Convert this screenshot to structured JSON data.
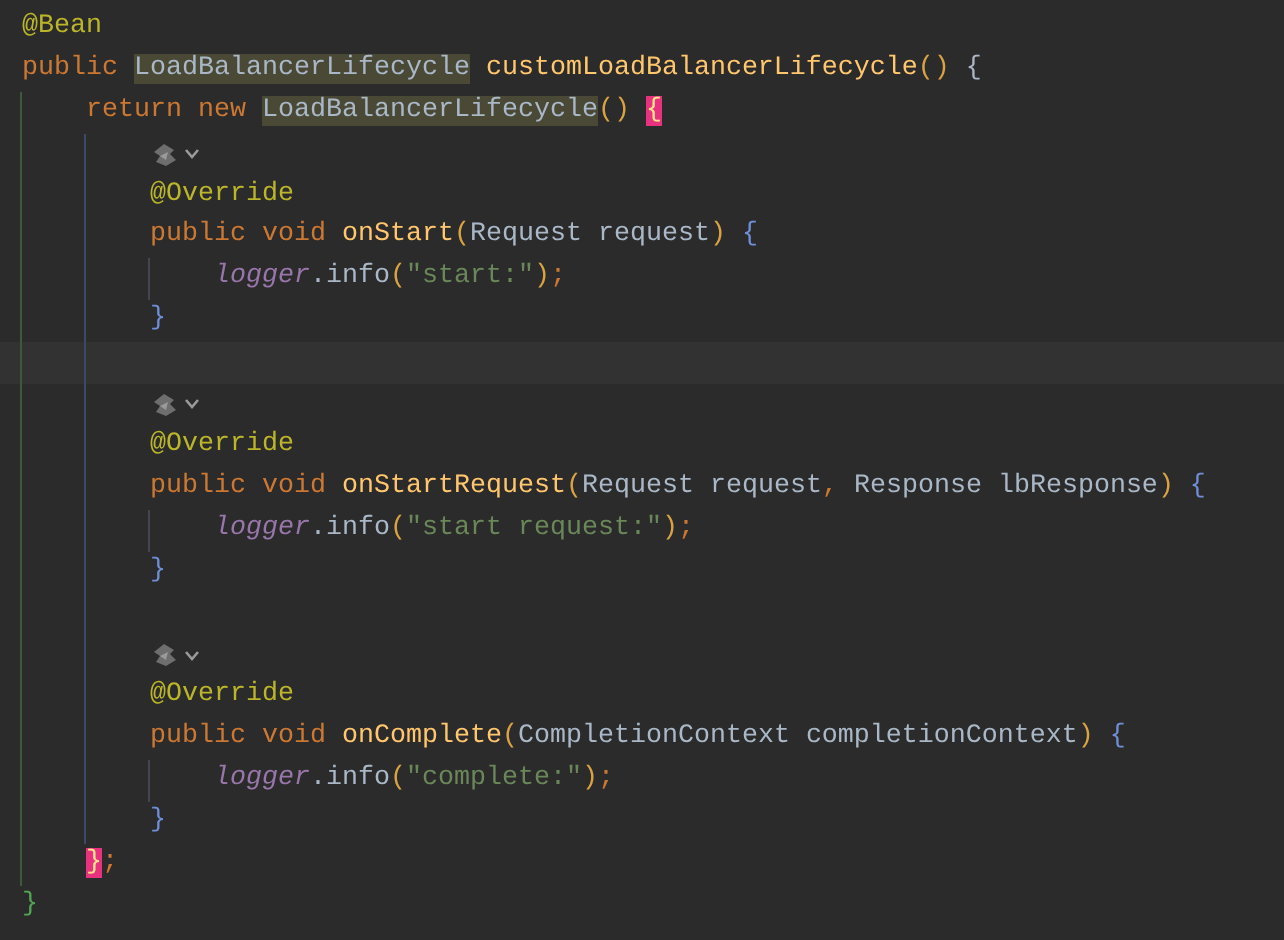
{
  "editor": {
    "lines": [
      {
        "kind": "code",
        "tokens": [
          {
            "kind": "annotation",
            "text": "@Bean"
          }
        ]
      },
      {
        "kind": "code",
        "tokens": [
          {
            "kind": "keyword",
            "text": "public "
          },
          {
            "kind": "type_usage",
            "text": "LoadBalancerLifecycle"
          },
          {
            "kind": "method",
            "text": " customLoadBalancerLifecycle"
          },
          {
            "kind": "bracket_1",
            "text": "()"
          },
          {
            "kind": "identifier",
            "text": " {"
          }
        ],
        "children": [
          {
            "kind": "code",
            "tokens": [
              {
                "kind": "keyword",
                "text": "return new "
              },
              {
                "kind": "type_usage",
                "text": "LoadBalancerLifecycle"
              },
              {
                "kind": "bracket_1",
                "text": "() "
              },
              {
                "kind": "bracket_match",
                "text": "{"
              }
            ],
            "children": [
              {
                "kind": "marker"
              },
              {
                "kind": "code",
                "tokens": [
                  {
                    "kind": "annotation",
                    "text": "@Override"
                  }
                ]
              },
              {
                "kind": "code",
                "tokens": [
                  {
                    "kind": "keyword",
                    "text": "public void "
                  },
                  {
                    "kind": "method",
                    "text": "onStart"
                  },
                  {
                    "kind": "bracket_1",
                    "text": "("
                  },
                  {
                    "kind": "type",
                    "text": "Request "
                  },
                  {
                    "kind": "identifier",
                    "text": "request"
                  },
                  {
                    "kind": "bracket_1",
                    "text": ")"
                  },
                  {
                    "kind": "bracket_2",
                    "text": " {"
                  }
                ],
                "children": [
                  {
                    "kind": "code",
                    "tokens": [
                      {
                        "kind": "field",
                        "text": "logger"
                      },
                      {
                        "kind": "identifier",
                        "text": ".info"
                      },
                      {
                        "kind": "bracket_1",
                        "text": "("
                      },
                      {
                        "kind": "string",
                        "text": "\"start:\""
                      },
                      {
                        "kind": "bracket_1",
                        "text": ")"
                      },
                      {
                        "kind": "punct",
                        "text": ";"
                      }
                    ]
                  }
                ]
              },
              {
                "kind": "code",
                "tokens": [
                  {
                    "kind": "bracket_2",
                    "text": "}"
                  }
                ]
              },
              {
                "kind": "current_line"
              },
              {
                "kind": "marker"
              },
              {
                "kind": "code",
                "tokens": [
                  {
                    "kind": "annotation",
                    "text": "@Override"
                  }
                ]
              },
              {
                "kind": "code",
                "tokens": [
                  {
                    "kind": "keyword",
                    "text": "public void "
                  },
                  {
                    "kind": "method",
                    "text": "onStartRequest"
                  },
                  {
                    "kind": "bracket_1",
                    "text": "("
                  },
                  {
                    "kind": "type",
                    "text": "Request "
                  },
                  {
                    "kind": "identifier",
                    "text": "request"
                  },
                  {
                    "kind": "punct",
                    "text": ", "
                  },
                  {
                    "kind": "type",
                    "text": "Response "
                  },
                  {
                    "kind": "identifier",
                    "text": "lbResponse"
                  },
                  {
                    "kind": "bracket_1",
                    "text": ")"
                  },
                  {
                    "kind": "bracket_2",
                    "text": " {"
                  }
                ],
                "children": [
                  {
                    "kind": "code",
                    "tokens": [
                      {
                        "kind": "field",
                        "text": "logger"
                      },
                      {
                        "kind": "identifier",
                        "text": ".info"
                      },
                      {
                        "kind": "bracket_1",
                        "text": "("
                      },
                      {
                        "kind": "string",
                        "text": "\"start request:\""
                      },
                      {
                        "kind": "bracket_1",
                        "text": ")"
                      },
                      {
                        "kind": "punct",
                        "text": ";"
                      }
                    ]
                  }
                ]
              },
              {
                "kind": "code",
                "tokens": [
                  {
                    "kind": "bracket_2",
                    "text": "}"
                  }
                ]
              },
              {
                "kind": "blank"
              },
              {
                "kind": "marker"
              },
              {
                "kind": "code",
                "tokens": [
                  {
                    "kind": "annotation",
                    "text": "@Override"
                  }
                ]
              },
              {
                "kind": "code",
                "tokens": [
                  {
                    "kind": "keyword",
                    "text": "public void "
                  },
                  {
                    "kind": "method",
                    "text": "onComplete"
                  },
                  {
                    "kind": "bracket_1",
                    "text": "("
                  },
                  {
                    "kind": "type",
                    "text": "CompletionContext "
                  },
                  {
                    "kind": "identifier",
                    "text": "completionContext"
                  },
                  {
                    "kind": "bracket_1",
                    "text": ")"
                  },
                  {
                    "kind": "bracket_2",
                    "text": " {"
                  }
                ],
                "children": [
                  {
                    "kind": "code",
                    "tokens": [
                      {
                        "kind": "field",
                        "text": "logger"
                      },
                      {
                        "kind": "identifier",
                        "text": ".info"
                      },
                      {
                        "kind": "bracket_1",
                        "text": "("
                      },
                      {
                        "kind": "string",
                        "text": "\"complete:\""
                      },
                      {
                        "kind": "bracket_1",
                        "text": ")"
                      },
                      {
                        "kind": "punct",
                        "text": ";"
                      }
                    ]
                  }
                ]
              },
              {
                "kind": "code",
                "tokens": [
                  {
                    "kind": "bracket_2",
                    "text": "}"
                  }
                ]
              }
            ]
          },
          {
            "kind": "code",
            "tokens": [
              {
                "kind": "bracket_match",
                "text": "}"
              },
              {
                "kind": "punct",
                "text": ";"
              }
            ]
          }
        ]
      },
      {
        "kind": "code",
        "tokens": [
          {
            "kind": "bracket_3",
            "text": "}"
          }
        ]
      }
    ]
  }
}
